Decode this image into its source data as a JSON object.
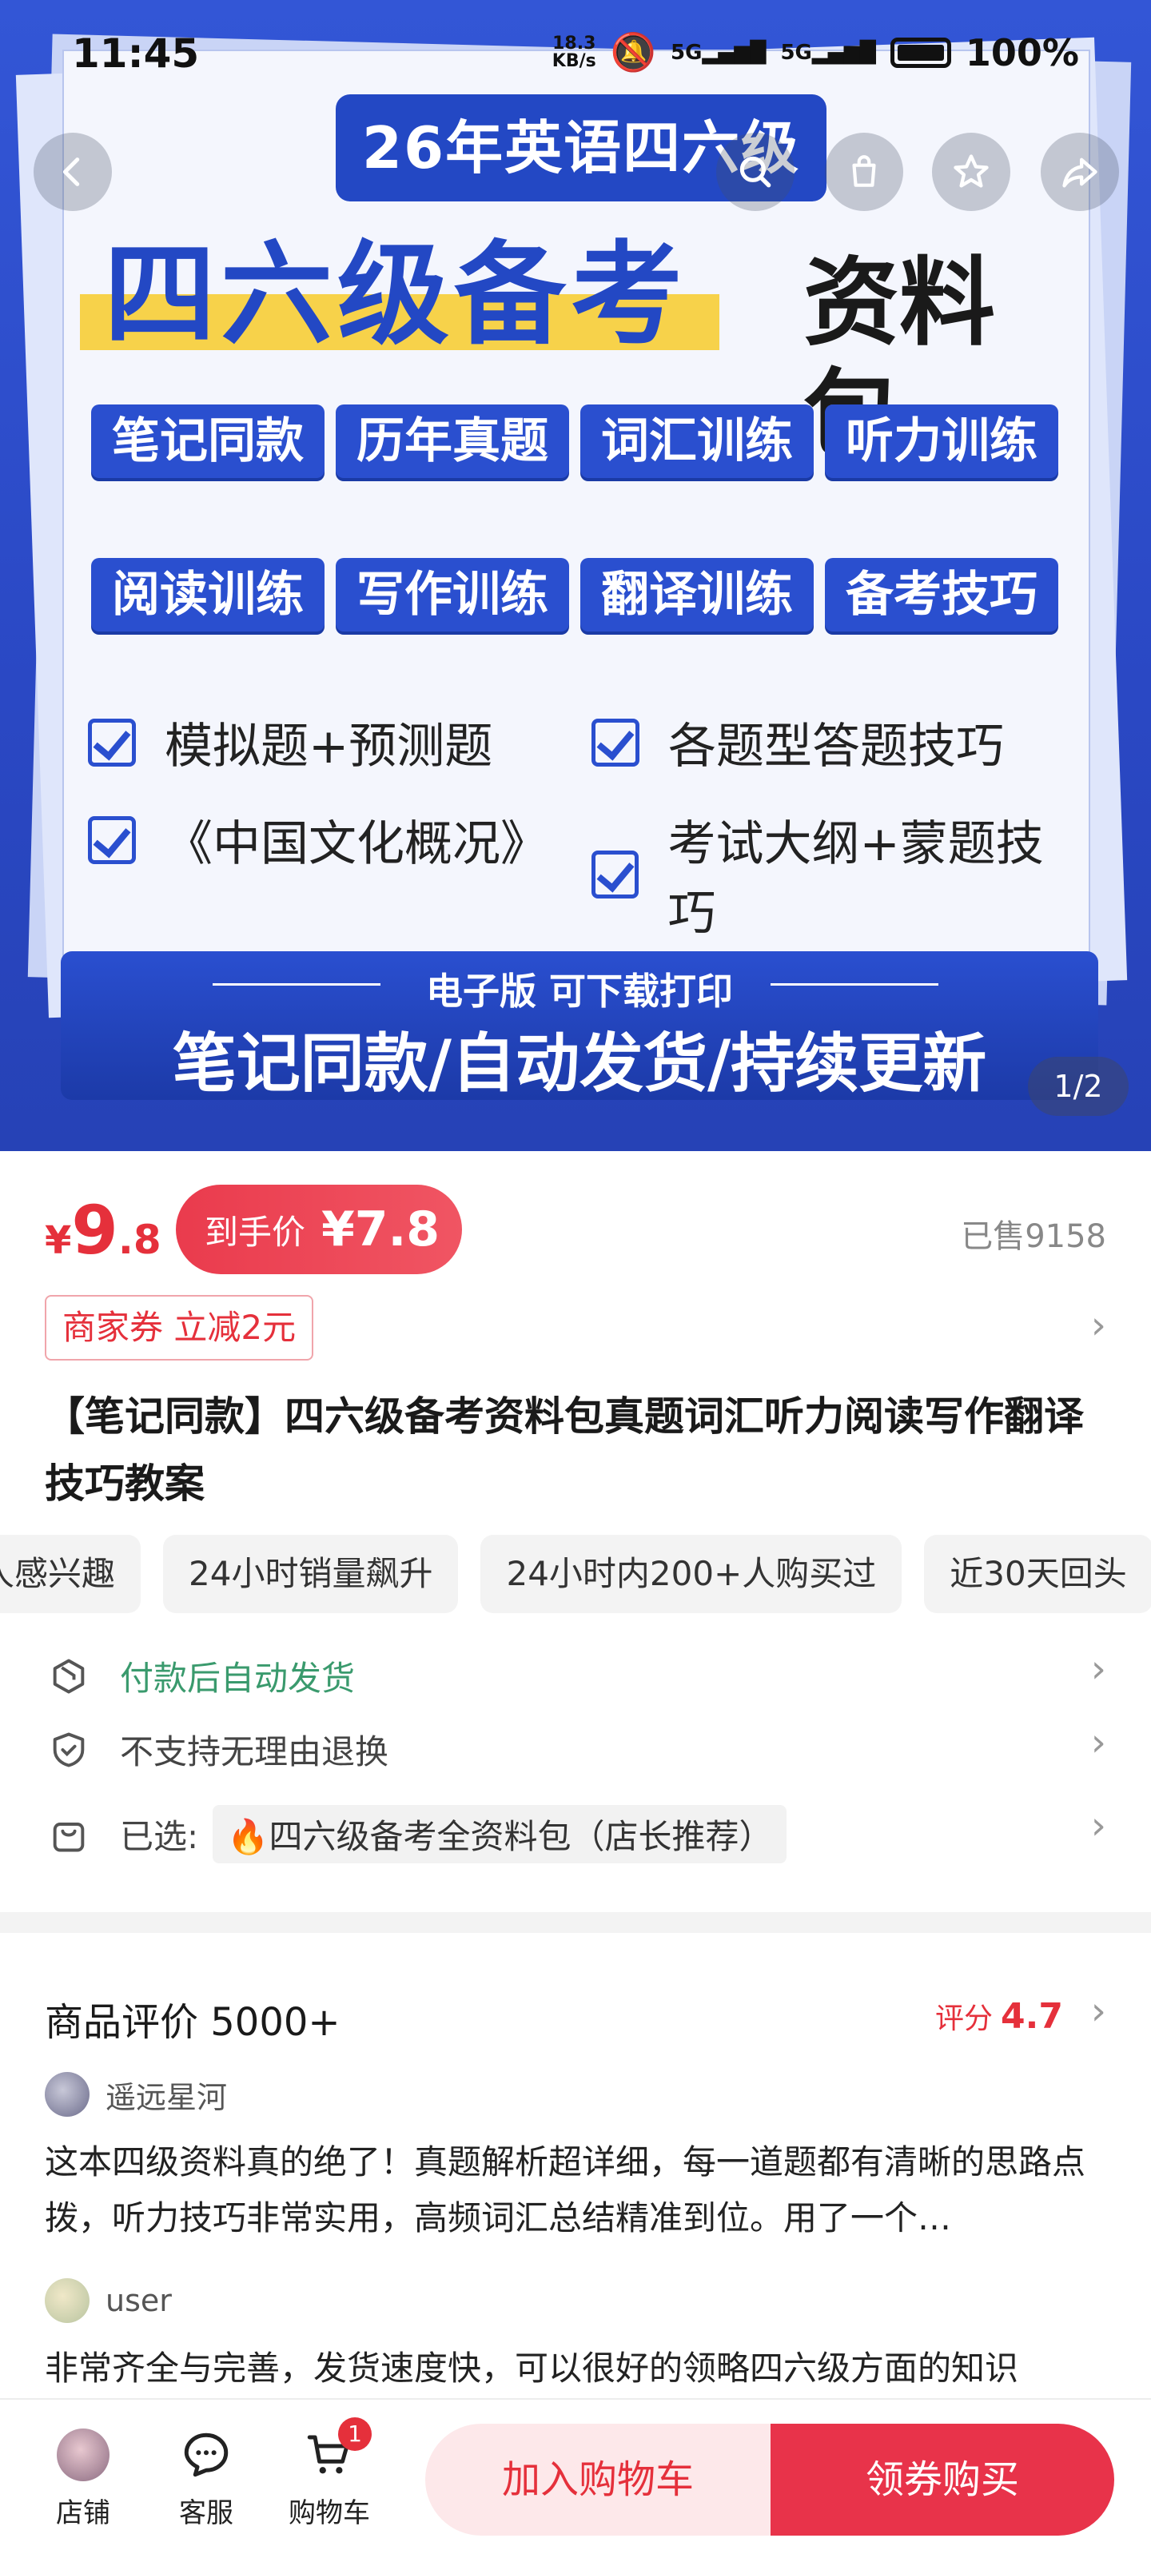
{
  "status_bar": {
    "time": "11:45",
    "speed_value": "18.3",
    "speed_unit": "KB/s",
    "sim1": "5G",
    "sim2": "5G",
    "battery": "100%"
  },
  "hero": {
    "badge": "26年英语四六级",
    "title_main": "四六级备考",
    "title_sub": "资料包",
    "tags": [
      "笔记同款",
      "历年真题",
      "词汇训练",
      "听力训练",
      "阅读训练",
      "写作训练",
      "翻译训练",
      "备考技巧"
    ],
    "checks": [
      "模拟题+预测题",
      "各题型答题技巧",
      "《中国文化概况》",
      "考试大纲+蒙题技巧"
    ],
    "banner_sub": "电子版  可下载打印",
    "banner_main": "笔记同款/自动发货/持续更新",
    "pager": "1/2"
  },
  "price": {
    "currency": "¥",
    "int": "9",
    "dec": ".8",
    "deal_label": "到手价",
    "deal_value": "¥7.8",
    "sold": "已售9158",
    "coupon": "商家券 立减2元"
  },
  "product_title": "【笔记同款】四六级备考资料包真题词汇听力阅读写作翻译技巧教案",
  "hot_tags": [
    "人感兴趣",
    "24小时销量飙升",
    "24小时内200+人购买过",
    "近30天回头"
  ],
  "info": {
    "delivery": "付款后自动发货",
    "returns": "不支持无理由退换",
    "selected_label": "已选:",
    "selected_value": "🔥四六级备考全资料包（店长推荐）"
  },
  "reviews": {
    "title": "商品评价 5000+",
    "score_label": "评分",
    "score": "4.7",
    "items": [
      {
        "user": "遥远星河",
        "text": "这本四级资料真的绝了！真题解析超详细，每一道题都有清晰的思路点拨，听力技巧非常实用，高频词汇总结精准到位。用了一个…"
      },
      {
        "user": "user",
        "text": "非常齐全与完善，发货速度快，可以很好的领略四六级方面的知识"
      }
    ]
  },
  "bottom_bar": {
    "shop": "店铺",
    "service": "客服",
    "cart": "购物车",
    "cart_count": "1",
    "add_cart": "加入购物车",
    "buy": "领券购买"
  },
  "colors": {
    "accent": "#e5303b",
    "hero_blue": "#2a4fcf",
    "highlight_yellow": "#f7d24a",
    "green": "#3a9a6d"
  }
}
